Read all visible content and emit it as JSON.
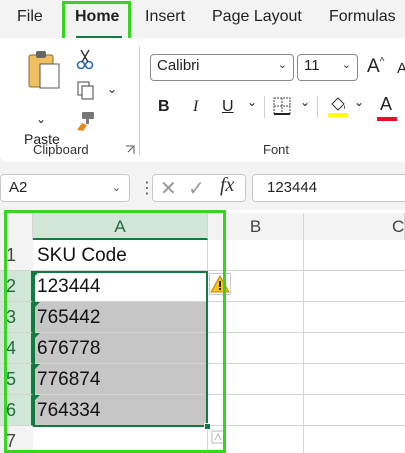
{
  "tabs": [
    "File",
    "Home",
    "Insert",
    "Page Layout",
    "Formulas"
  ],
  "ribbon": {
    "clipboard": {
      "paste_label": "Paste",
      "group_label": "Clipboard",
      "icons": [
        "paste-icon",
        "cut-icon",
        "copy-icon",
        "format-painter-icon",
        "dialog-launcher-icon"
      ]
    },
    "font": {
      "font_name": "Calibri",
      "font_size": "11",
      "grow_label": "A",
      "shrink_label": "A",
      "bold_label": "B",
      "italic_label": "I",
      "underline_label": "U",
      "font_color_label": "A",
      "group_label": "Font",
      "fill_color": "#ffff00",
      "font_color": "#e81123"
    }
  },
  "formula_bar": {
    "name_box": "A2",
    "cancel_label": "✕",
    "enter_label": "✓",
    "fx_label": "fx",
    "value": "123444"
  },
  "columns": [
    "A",
    "B",
    "C"
  ],
  "rows": [
    "1",
    "2",
    "3",
    "4",
    "5",
    "6",
    "7"
  ],
  "cells": {
    "a1": "SKU Code",
    "a2": "123444",
    "a3": "765442",
    "a4": "676778",
    "a5": "776874",
    "a6": "764334"
  },
  "colors": {
    "accent": "#107c41",
    "highlight": "#37d51f",
    "selection_fill": "#c6c6c6"
  }
}
